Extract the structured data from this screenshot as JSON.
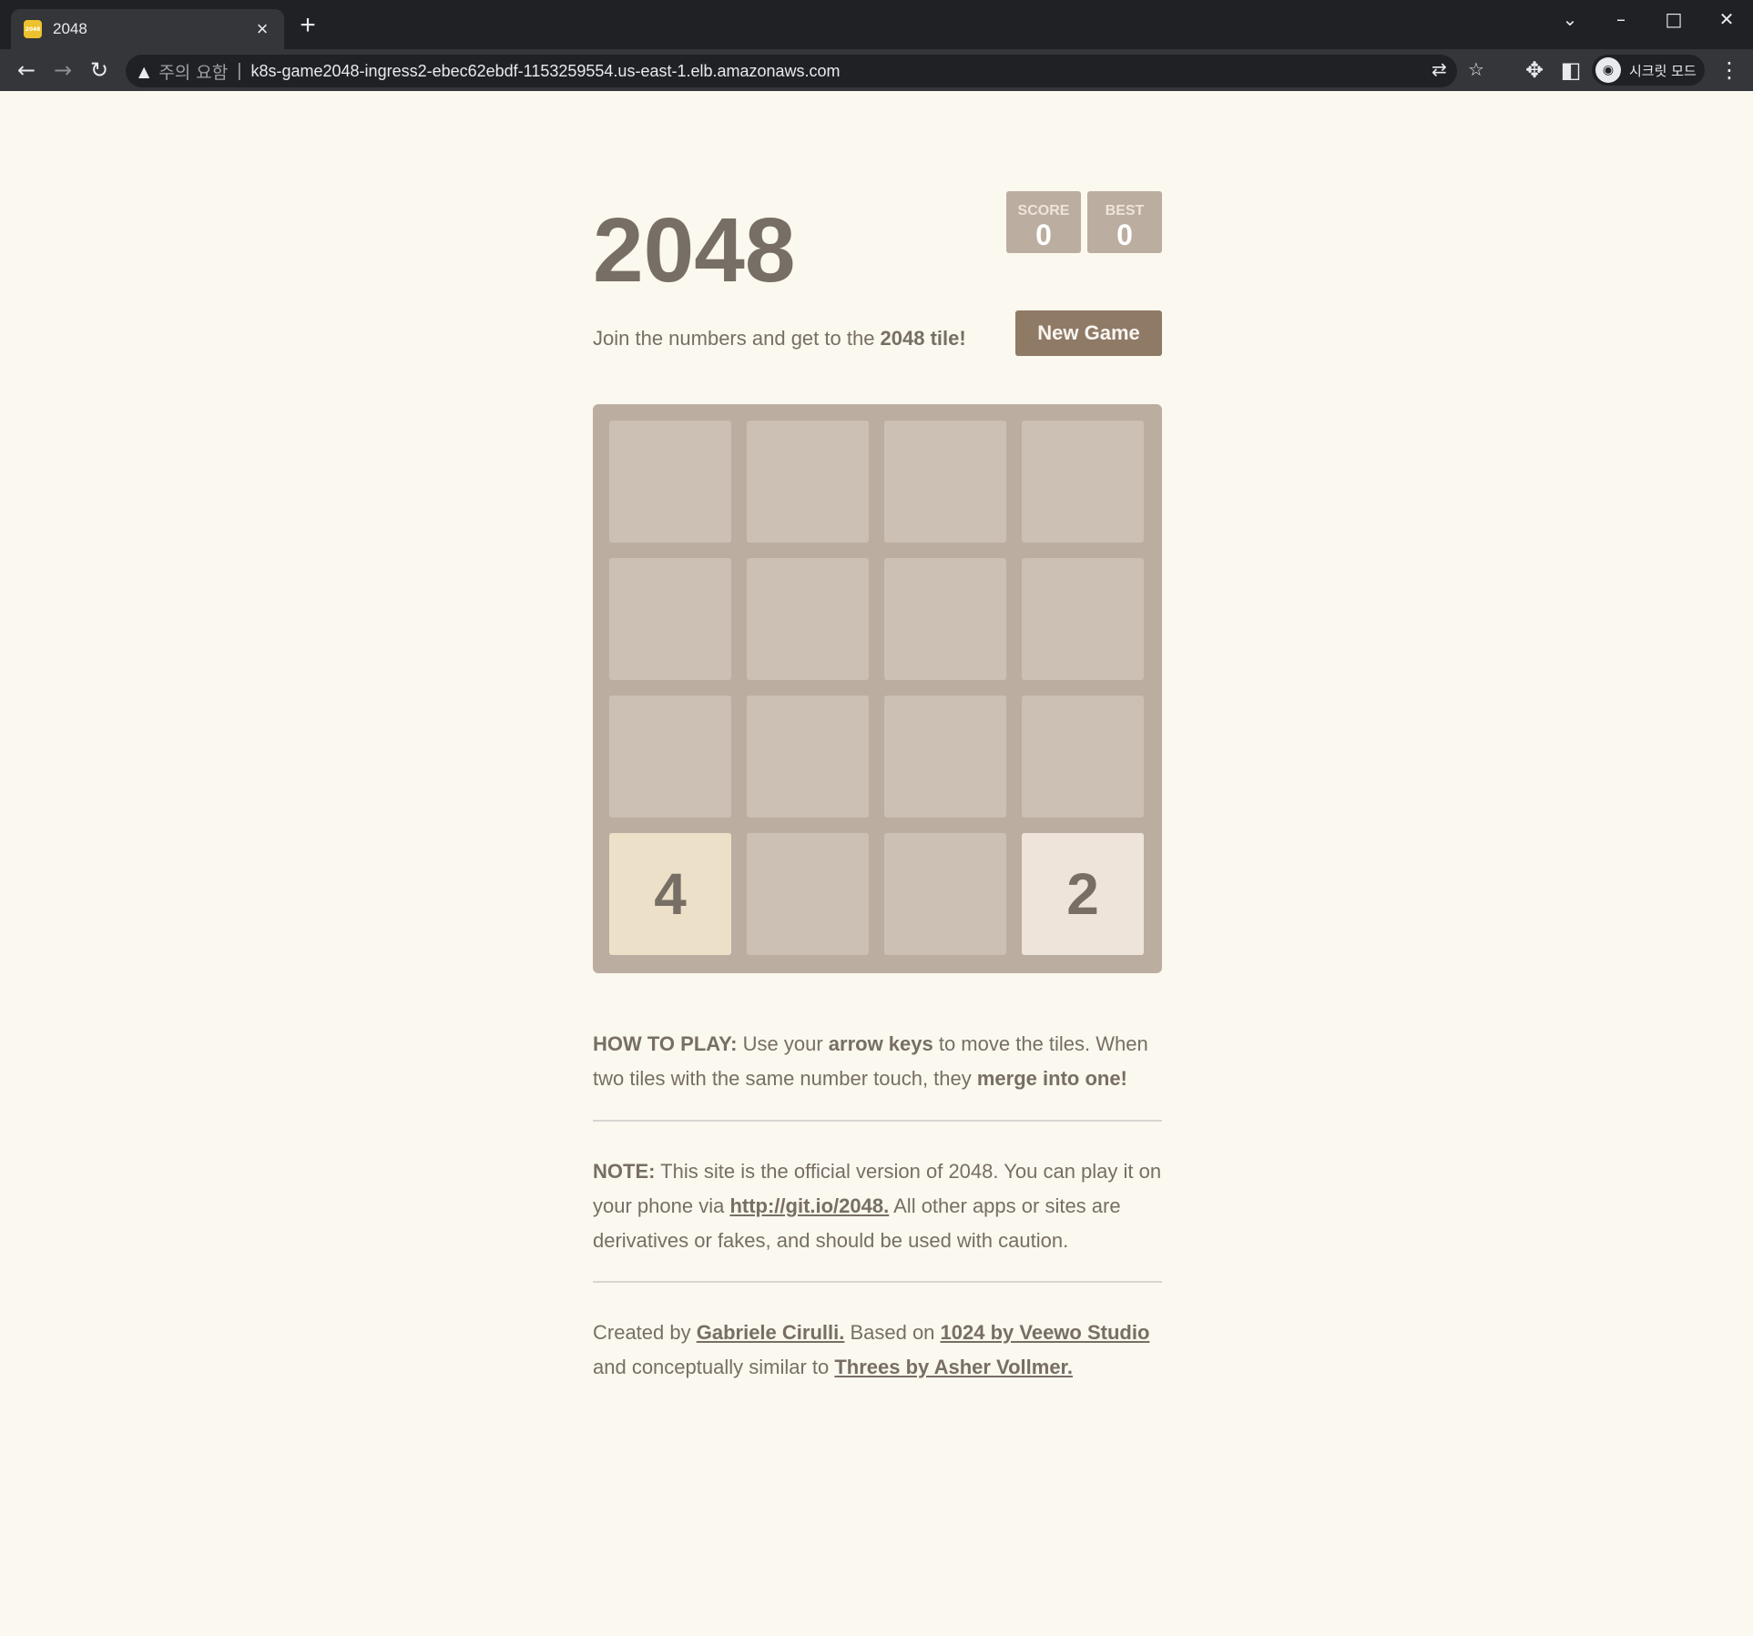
{
  "browser": {
    "tab_title": "2048",
    "favicon_text": "2048",
    "new_tab": "+",
    "warning_label": "주의 요함",
    "url": "k8s-game2048-ingress2-ebec62ebdf-1153259554.us-east-1.elb.amazonaws.com",
    "profile_label": "시크릿 모드",
    "icons": {
      "back": "back-arrow-icon",
      "forward": "forward-arrow-icon",
      "reload": "reload-icon",
      "warning": "warning-icon",
      "translate": "translate-icon",
      "bookmark": "star-icon",
      "extensions": "puzzle-icon",
      "side_panel": "side-panel-icon",
      "menu": "kebab-menu-icon"
    }
  },
  "game": {
    "title": "2048",
    "score_label": "SCORE",
    "score_value": "0",
    "best_label": "BEST",
    "best_value": "0",
    "intro_text": "Join the numbers and get to the ",
    "intro_bold": "2048 tile!",
    "new_game_label": "New Game",
    "board": [
      [
        null,
        null,
        null,
        null
      ],
      [
        null,
        null,
        null,
        null
      ],
      [
        null,
        null,
        null,
        null
      ],
      [
        4,
        null,
        null,
        2
      ]
    ],
    "tile_colors": {
      "2": "#eee4da",
      "4": "#ede0c8"
    }
  },
  "how_to_play": {
    "label": "HOW TO PLAY:",
    "t1": " Use your ",
    "b1": "arrow keys",
    "t2": " to move the tiles. When two tiles with the same number touch, they ",
    "b2": "merge into one!"
  },
  "note": {
    "label": "NOTE:",
    "t1": " This site is the official version of 2048. You can play it on your phone via ",
    "link": "http://git.io/2048.",
    "t2": " All other apps or sites are derivatives or fakes, and should be used with caution."
  },
  "credits": {
    "t1": "Created by ",
    "link1": "Gabriele Cirulli.",
    "t2": " Based on ",
    "link2": "1024 by Veewo Studio",
    "t3": " and conceptually similar to ",
    "link3": "Threes by Asher Vollmer."
  }
}
